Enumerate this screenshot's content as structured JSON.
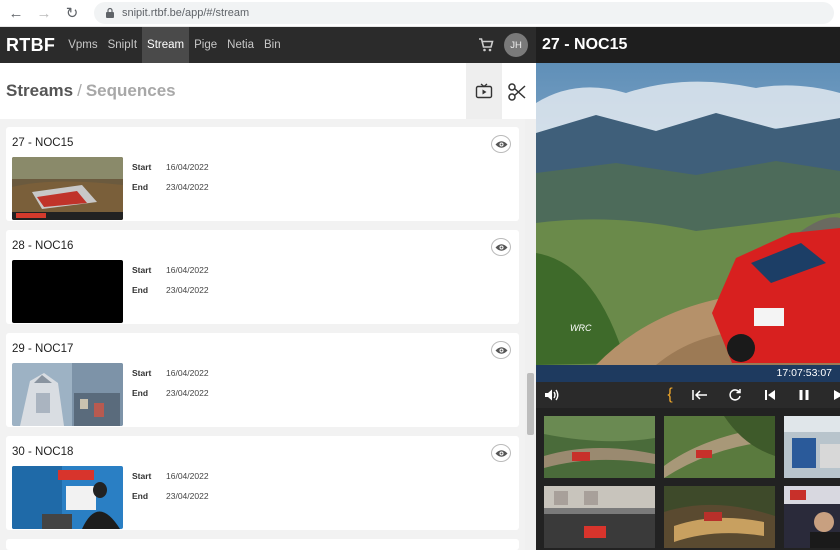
{
  "browser": {
    "url": "snipit.rtbf.be/app/#/stream"
  },
  "navbar": {
    "brand": "RTBF",
    "items": [
      "Vpms",
      "SnipIt",
      "Stream",
      "Pige",
      "Netia",
      "Bin"
    ],
    "active": "Stream",
    "avatar_initials": "JH"
  },
  "breadcrumb": {
    "current": "Streams",
    "separator": "/",
    "sub": "Sequences"
  },
  "streams": [
    {
      "title": "27 - NOC15",
      "start_label": "Start",
      "start": "16/04/2022",
      "end_label": "End",
      "end": "23/04/2022"
    },
    {
      "title": "28 - NOC16",
      "start_label": "Start",
      "start": "16/04/2022",
      "end_label": "End",
      "end": "23/04/2022"
    },
    {
      "title": "29 - NOC17",
      "start_label": "Start",
      "start": "16/04/2022",
      "end_label": "End",
      "end": "23/04/2022"
    },
    {
      "title": "30 - NOC18",
      "start_label": "Start",
      "start": "16/04/2022",
      "end_label": "End",
      "end": "23/04/2022"
    }
  ],
  "player": {
    "title": "27 - NOC15",
    "timecode": "17:07:53:07",
    "overlay_logo": "WRC"
  }
}
